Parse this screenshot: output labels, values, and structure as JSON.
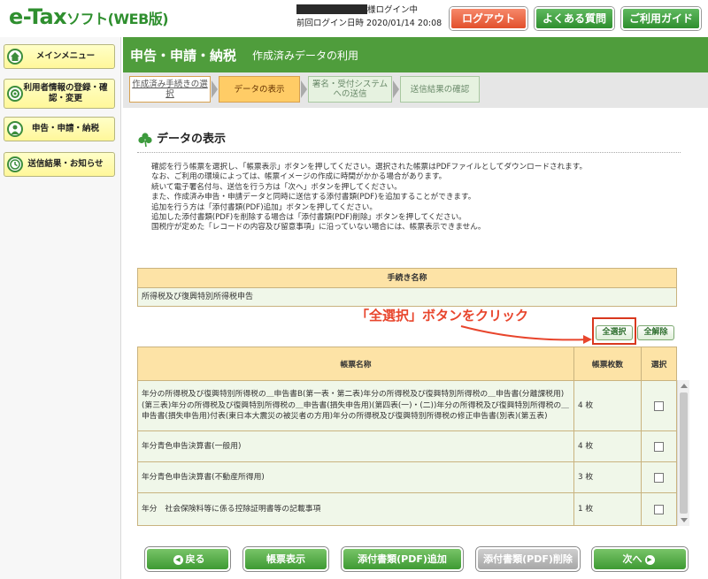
{
  "header": {
    "logo_main": "e-Tax",
    "logo_sub": "ソフト(WEB版)",
    "login_status": "様ログイン中",
    "last_login_label": "前回ログイン日時",
    "last_login_value": "2020/01/14 20:08",
    "logout_label": "ログアウト",
    "faq_label": "よくある質問",
    "guide_label": "ご利用ガイド"
  },
  "sidebar": {
    "items": [
      {
        "label": "メインメニュー"
      },
      {
        "label": "利用者情報の登録・確認・変更"
      },
      {
        "label": "申告・申請・納税"
      },
      {
        "label": "送信結果・お知らせ"
      }
    ]
  },
  "page": {
    "title": "申告・申請・納税",
    "subtitle": "作成済みデータの利用"
  },
  "steps": [
    {
      "label": "作成済み手続きの選択"
    },
    {
      "label": "データの表示"
    },
    {
      "label": "署名・受付システムへの送信"
    },
    {
      "label": "送信結果の確認"
    }
  ],
  "section": {
    "title": "データの表示",
    "description": [
      "確認を行う帳票を選択し、「帳票表示」ボタンを押してください。選択された帳票はPDFファイルとしてダウンロードされます。",
      "なお、ご利用の環境によっては、帳票イメージの作成に時間がかかる場合があります。",
      "続いて電子署名付与、送信を行う方は「次へ」ボタンを押してください。",
      "また、作成済み申告・申請データと同時に送信する添付書類(PDF)を追加することができます。",
      "追加を行う方は「添付書類(PDF)追加」ボタンを押してください。",
      "追加した添付書類(PDF)を削除する場合は「添付書類(PDF)削除」ボタンを押してください。",
      "国税庁が定めた「レコードの内容及び留意事項」に沿っていない場合には、帳票表示できません。"
    ]
  },
  "procedure_table": {
    "header": "手続き名称",
    "value": "所得税及び復興特別所得税申告"
  },
  "annotation": {
    "text": "「全選択」ボタンをクリック"
  },
  "selection_buttons": {
    "select_all": "全選択",
    "clear_all": "全解除"
  },
  "forms_table": {
    "headers": {
      "name": "帳票名称",
      "count": "帳票枚数",
      "select": "選択"
    },
    "rows": [
      {
        "name": "年分の所得税及び復興特別所得税の＿申告書B(第一表・第二表)年分の所得税及び復興特別所得税の＿申告書(分離課税用)(第三表)年分の所得税及び復興特別所得税の＿申告書(損失申告用)(第四表(一)・(二))年分の所得税及び復興特別所得税の＿申告書(損失申告用)付表(東日本大震災の被災者の方用)年分の所得税及び復興特別所得税の修正申告書(別表)(第五表)",
        "count": "4 枚"
      },
      {
        "name": "年分青色申告決算書(一般用)",
        "count": "4 枚"
      },
      {
        "name": "年分青色申告決算書(不動産所得用)",
        "count": "3 枚"
      },
      {
        "name": "年分　社会保険料等に係る控除証明書等の記載事項",
        "count": "1 枚"
      }
    ]
  },
  "bottom_buttons": {
    "back": "戻る",
    "display": "帳票表示",
    "attach_add": "添付書類(PDF)追加",
    "attach_delete": "添付書類(PDF)削除",
    "next": "次へ"
  },
  "colors": {
    "brand_green": "#4f9d3c",
    "step_active": "#ffcc66",
    "annotation_red": "#e8452c",
    "table_header": "#fde3a6",
    "table_row": "#f0f7e9"
  }
}
